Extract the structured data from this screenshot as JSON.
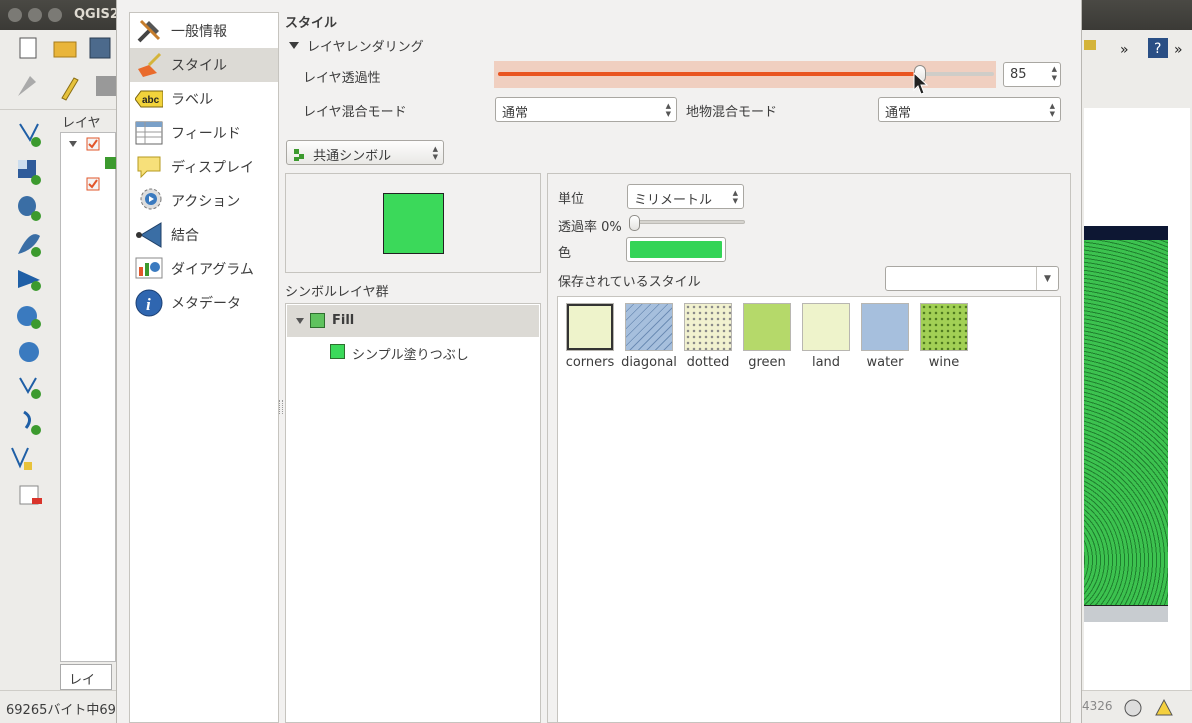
{
  "background_window": {
    "title": "QGIS2",
    "layers_panel_title": "レイヤ",
    "layers_tab_label": "レイヤ",
    "status_text": "69265バイト中69",
    "right_status": "4326"
  },
  "dialog": {
    "nav_items": [
      {
        "label": "一般情報",
        "icon": "tools-icon"
      },
      {
        "label": "スタイル",
        "icon": "brush-icon"
      },
      {
        "label": "ラベル",
        "icon": "abc-label-icon"
      },
      {
        "label": "フィールド",
        "icon": "table-icon"
      },
      {
        "label": "ディスプレイ",
        "icon": "speech-bubble-icon"
      },
      {
        "label": "アクション",
        "icon": "gear-action-icon"
      },
      {
        "label": "結合",
        "icon": "join-icon"
      },
      {
        "label": "ダイアグラム",
        "icon": "diagram-icon"
      },
      {
        "label": "メタデータ",
        "icon": "info-icon"
      }
    ],
    "section_title": "スタイル",
    "layer_rendering": {
      "header": "レイヤレンダリング",
      "transparency_label": "レイヤ透過性",
      "transparency_value": "85",
      "transparency_fraction": 0.85,
      "blend_mode_label": "レイヤ混合モード",
      "blend_mode_value": "通常",
      "feature_blend_label": "地物混合モード",
      "feature_blend_value": "通常"
    },
    "renderer_value": "共通シンボル",
    "symbol_layers_label": "シンボルレイヤ群",
    "symbol_tree": {
      "root": "Fill",
      "child": "シンプル塗りつぶし"
    },
    "symbol_props": {
      "unit_label": "単位",
      "unit_value": "ミリメートル",
      "opacity_label": "透過率 0%",
      "color_label": "色",
      "color_value": "#34d457",
      "saved_styles_label": "保存されているスタイル",
      "saved_styles_value": ""
    },
    "styles": [
      {
        "name": "corners",
        "color": "#eef3cb"
      },
      {
        "name": "diagonal",
        "color": "#a6bfdd"
      },
      {
        "name": "dotted",
        "color": "#f1f1cf"
      },
      {
        "name": "green",
        "color": "#b5d96a"
      },
      {
        "name": "land",
        "color": "#eef3cb"
      },
      {
        "name": "water",
        "color": "#a6bfdd"
      },
      {
        "name": "wine",
        "color": "#a2d055"
      }
    ],
    "preview_color": "#3bd95a"
  }
}
